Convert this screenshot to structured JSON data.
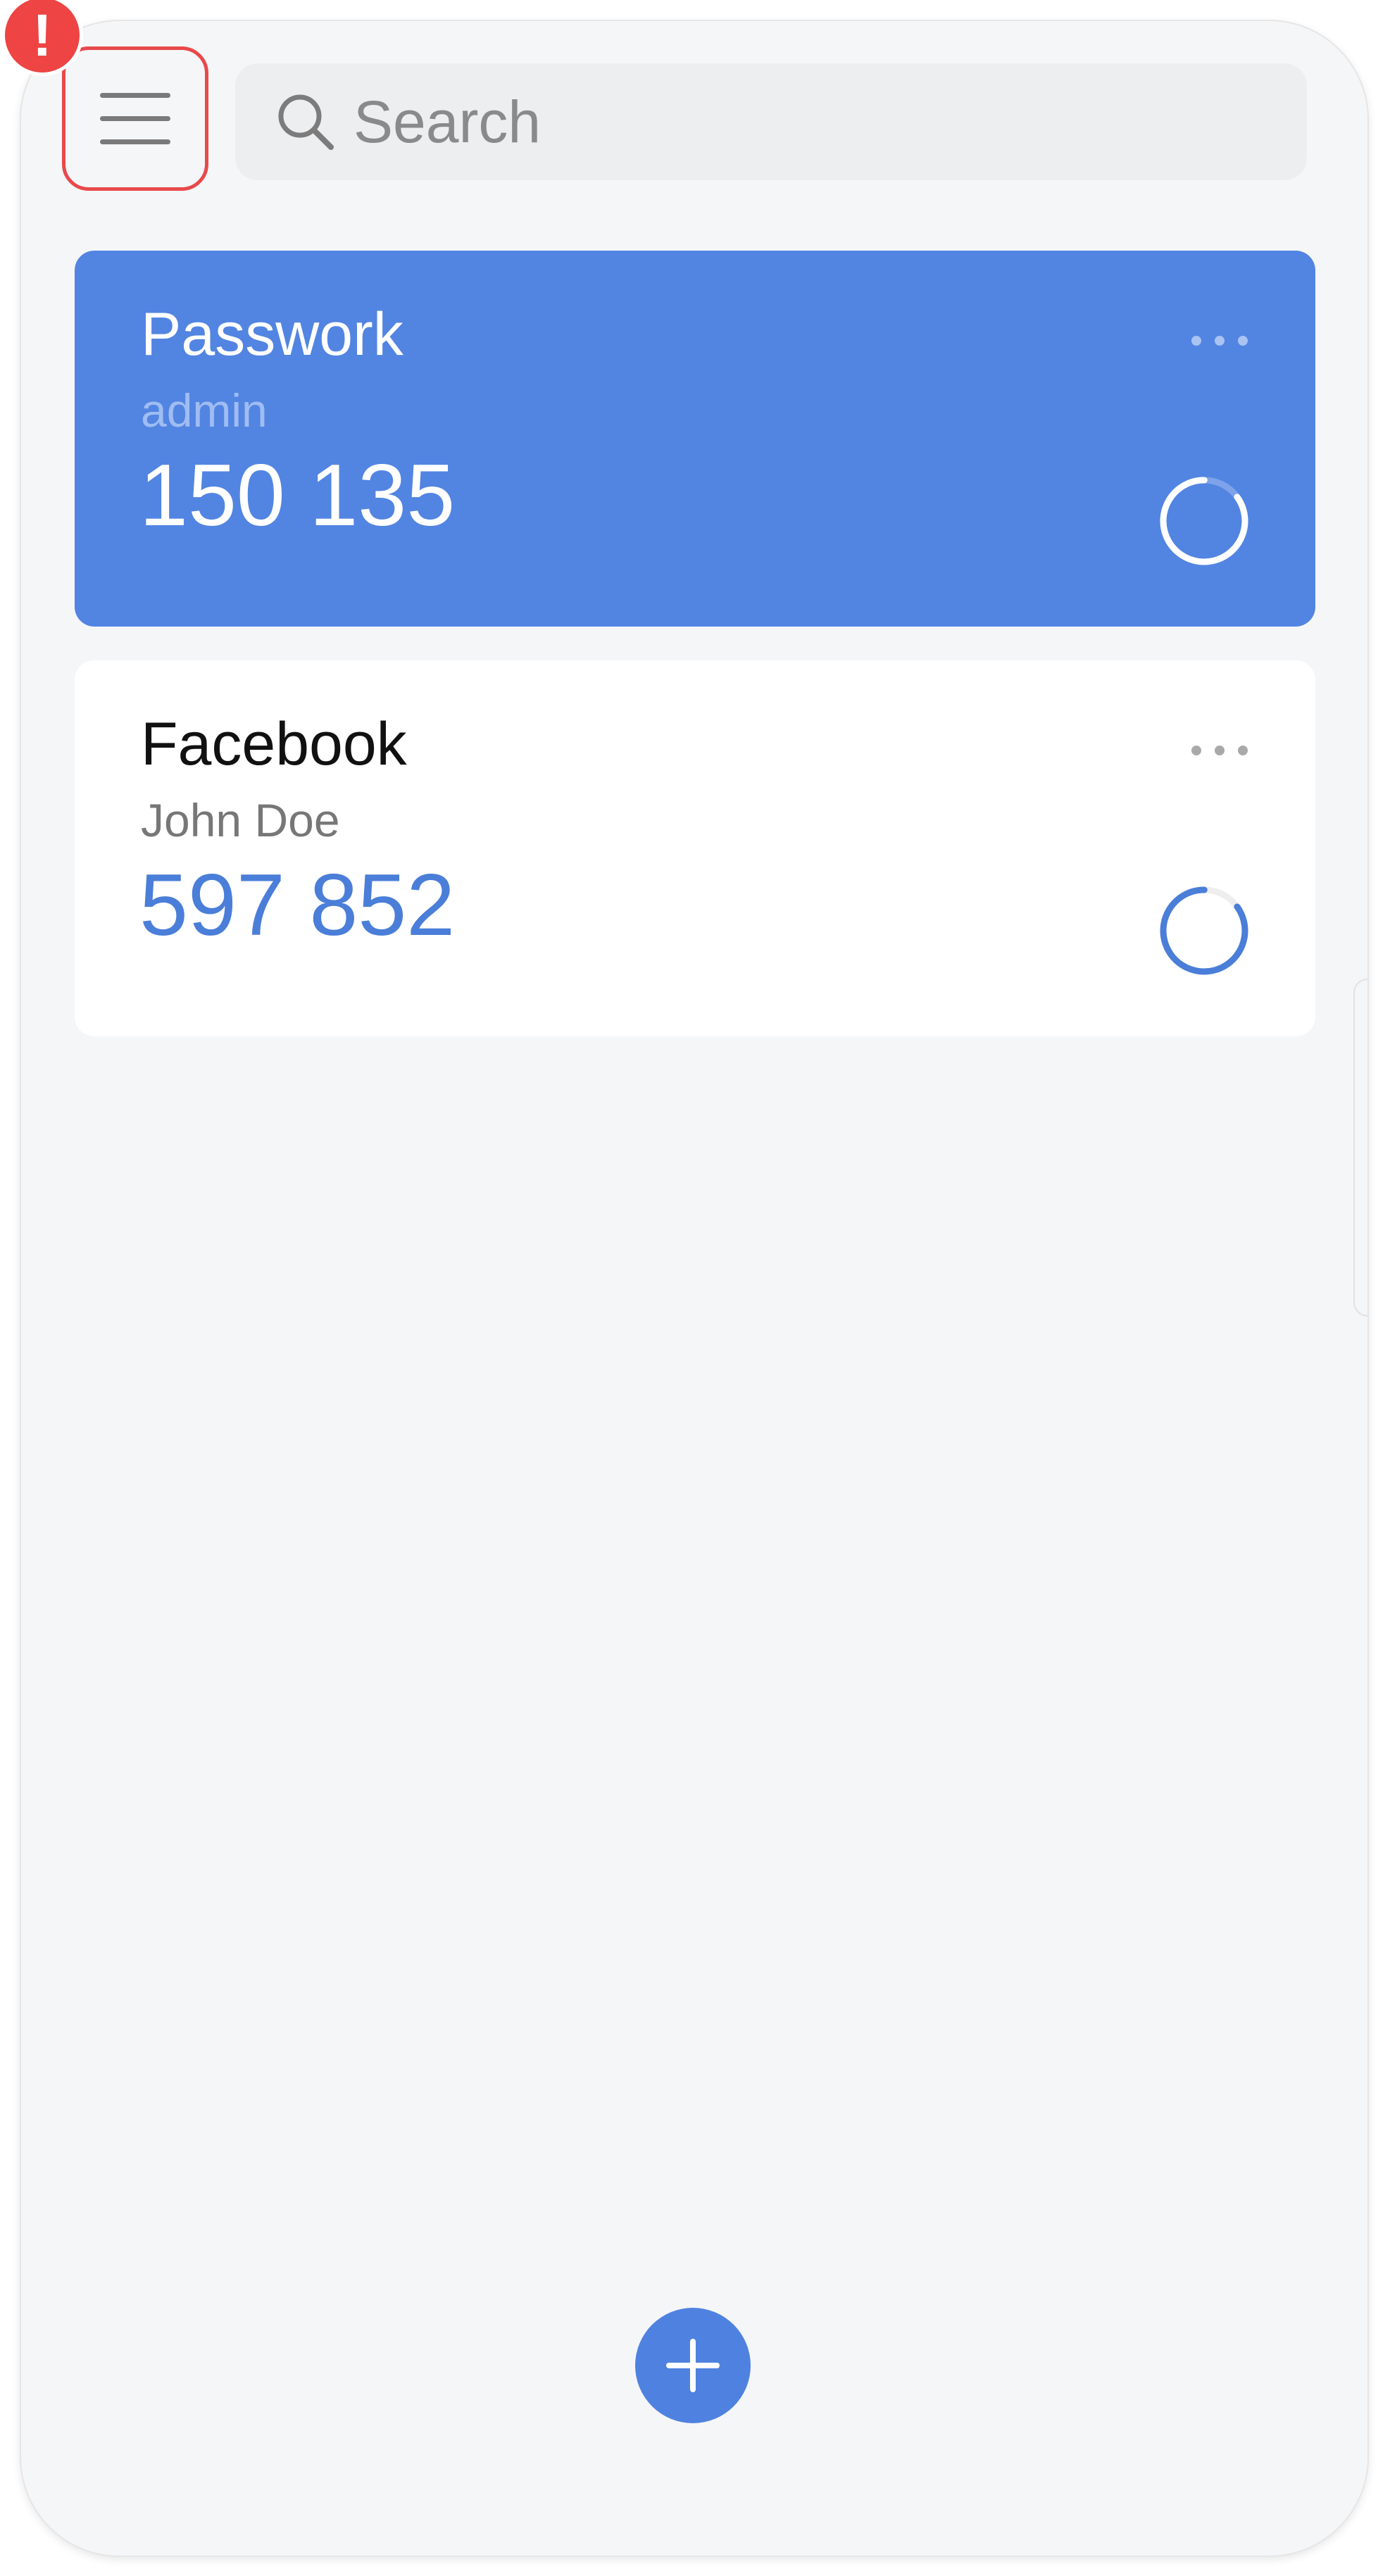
{
  "header": {
    "alert_symbol": "!",
    "search": {
      "placeholder": "Search",
      "value": ""
    }
  },
  "accounts": [
    {
      "name": "Passwork",
      "user": "admin",
      "code": "150 135",
      "selected": true,
      "timer_remaining_fraction": 0.85
    },
    {
      "name": "Facebook",
      "user": "John Doe",
      "code": "597 852",
      "selected": false,
      "timer_remaining_fraction": 0.85
    }
  ],
  "icons": {
    "menu": "hamburger-menu-icon",
    "alert": "exclamation-icon",
    "search": "search-icon",
    "more": "more-dots-icon",
    "timer": "countdown-ring-icon",
    "add": "plus-icon"
  },
  "colors": {
    "accent": "#5284e2",
    "alert": "#ee4444",
    "code_blue": "#4a7ed8",
    "background": "#f5f6f8"
  }
}
